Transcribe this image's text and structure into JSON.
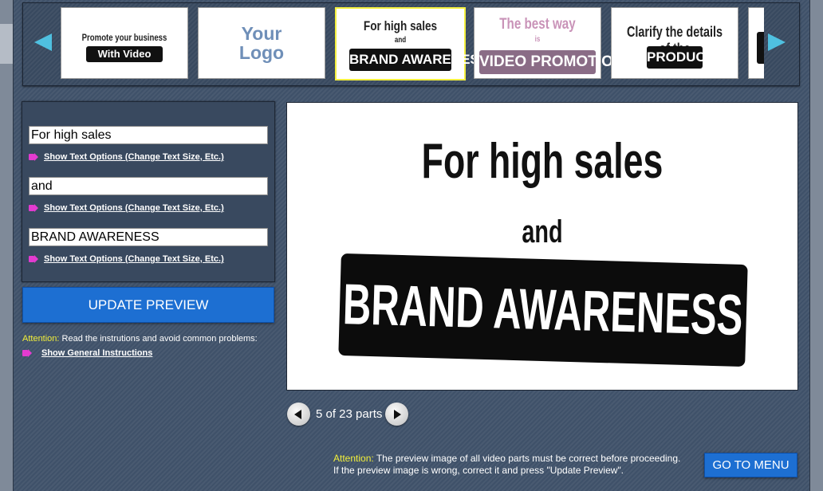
{
  "carousel": {
    "thumbnails": [
      {
        "line1": "Promote your business",
        "line2": "With Video"
      },
      {
        "line1": "Your",
        "line2": "Logo"
      },
      {
        "line1": "For high sales",
        "line2": "and",
        "line3": "BRAND AWARENESS"
      },
      {
        "line1": "The best way",
        "line2": "is",
        "line3": "VIDEO PROMOTION"
      },
      {
        "line1": "Clarify the details of the",
        "line2": "PRODUCT"
      }
    ]
  },
  "editor": {
    "fields": [
      {
        "value": "For high sales",
        "option_label": "Show Text Options (Change Text Size, Etc.)"
      },
      {
        "value": "and",
        "option_label": "Show Text Options (Change Text Size, Etc.)"
      },
      {
        "value": "BRAND AWARENESS",
        "option_label": "Show Text Options (Change Text Size, Etc.)"
      }
    ],
    "update_label": "UPDATE PREVIEW",
    "attention_label": "Attention:",
    "attention_text": " Read the instrutions and avoid common problems:",
    "general_instructions": "Show General Instructions"
  },
  "preview": {
    "line1": "For high sales",
    "line2": "and",
    "line3": "BRAND AWARENESS"
  },
  "pager": {
    "text": "5 of 23 parts"
  },
  "footer": {
    "attention_label": "Attention:",
    "line1": " The preview image of all video parts must be correct before proceeding.",
    "line2": "If the preview image is wrong, correct it and press \"Update Preview\".",
    "menu_label": "GO TO MENU"
  },
  "colors": {
    "accent": "#1d6fd2",
    "attention": "#f2ef3a",
    "arrow": "#4fc0e0",
    "bullet": "#e33bd0"
  }
}
